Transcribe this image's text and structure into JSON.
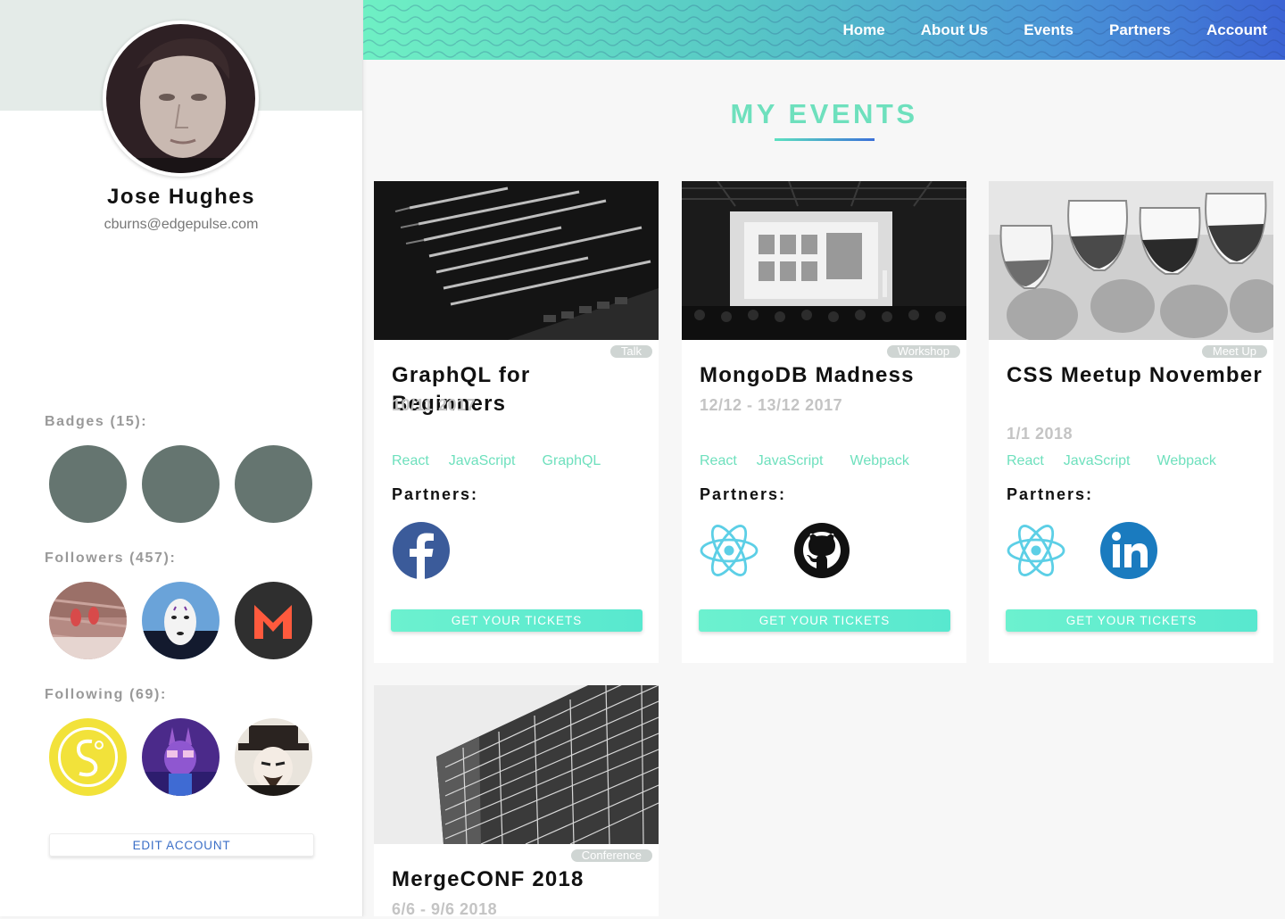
{
  "profile": {
    "name": "Jose Hughes",
    "email": "cburns@edgepulse.com",
    "badges_label": "Badges (15):",
    "followers_label": "Followers (457):",
    "following_label": "Following (69):",
    "edit_label": "EDIT ACCOUNT"
  },
  "nav": {
    "items": [
      "Home",
      "About Us",
      "Events",
      "Partners",
      "Account"
    ]
  },
  "main": {
    "title": "MY EVENTS"
  },
  "events": [
    {
      "type": "Talk",
      "title": "GraphQL for Beginners",
      "date": "10/11 2017",
      "tags": [
        "React",
        "JavaScript",
        "GraphQL"
      ],
      "partners_label": "Partners:",
      "partners": [
        "facebook-icon"
      ],
      "button": "GET YOUR TICKETS"
    },
    {
      "type": "Workshop",
      "title": "MongoDB Madness",
      "date": "12/12 - 13/12 2017",
      "tags": [
        "React",
        "JavaScript",
        "Webpack"
      ],
      "partners_label": "Partners:",
      "partners": [
        "react-icon",
        "github-icon"
      ],
      "button": "GET YOUR TICKETS"
    },
    {
      "type": "Meet Up",
      "title": "CSS Meetup November",
      "date": "1/1 2018",
      "tags": [
        "React",
        "JavaScript",
        "Webpack"
      ],
      "partners_label": "Partners:",
      "partners": [
        "react-icon",
        "linkedin-icon"
      ],
      "button": "GET YOUR TICKETS"
    },
    {
      "type": "Conference",
      "title": "MergeCONF 2018",
      "date": "6/6 - 9/6 2018"
    }
  ],
  "colors": {
    "accent": "#6ee0bd",
    "badge": "#657570",
    "link": "#3b6fc7"
  }
}
